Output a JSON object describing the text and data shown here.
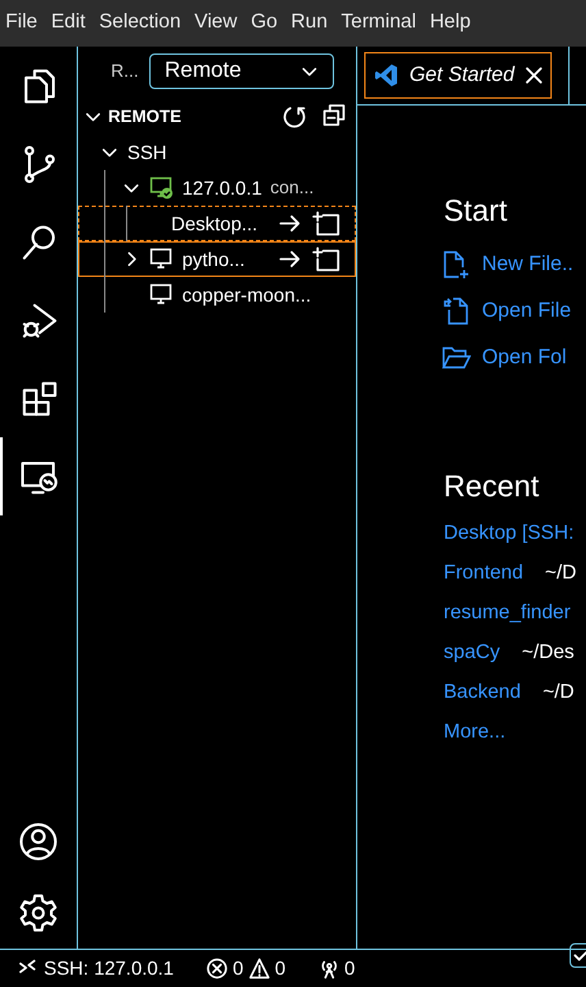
{
  "menu_bar": [
    "File",
    "Edit",
    "Selection",
    "View",
    "Go",
    "Run",
    "Terminal",
    "Help"
  ],
  "activity_bar": [
    {
      "kind": "files",
      "selected": false
    },
    {
      "kind": "branch",
      "selected": false
    },
    {
      "kind": "search",
      "selected": false
    },
    {
      "kind": "debug",
      "selected": false
    },
    {
      "kind": "extensions",
      "selected": false
    },
    {
      "kind": "remote",
      "selected": true
    }
  ],
  "activity_bar_bottom": [
    {
      "kind": "account"
    },
    {
      "kind": "settings"
    }
  ],
  "sidebar": {
    "label": "R...",
    "dropdown": "Remote",
    "section": {
      "title": "REMOTE",
      "expanded": true
    },
    "tree": [
      {
        "label": "SSH",
        "expanded": true,
        "children": [
          {
            "label": "127.0.0.1",
            "description": "con...",
            "kind": "connected-host",
            "expanded": true,
            "selected": false,
            "focused": false,
            "actions": false,
            "children": [
              {
                "label": "Desktop...",
                "selected": false,
                "focused": true,
                "actions": true
              }
            ]
          },
          {
            "label": "pytho...",
            "kind": "host",
            "expanded": false,
            "selected": true,
            "focused": false,
            "actions": true
          },
          {
            "label": "copper-moon...",
            "kind": "host",
            "selected": false,
            "focused": false,
            "actions": false
          }
        ]
      }
    ]
  },
  "tabs": [
    {
      "label": "Get Started",
      "selected": true
    }
  ],
  "start": {
    "title": "Start",
    "items": [
      {
        "kind": "new-file",
        "label": "New File.."
      },
      {
        "kind": "open-file",
        "label": "Open File"
      },
      {
        "kind": "open-folder",
        "label": "Open Fol"
      }
    ]
  },
  "recent": {
    "title": "Recent",
    "items": [
      {
        "name": "Desktop [SSH:"
      },
      {
        "name": "Frontend",
        "path": "~/D"
      },
      {
        "name": "resume_finder"
      },
      {
        "name": "spaCy",
        "path": "~/Des"
      },
      {
        "name": "Backend",
        "path": "~/D"
      }
    ],
    "more": "More..."
  },
  "show_on_startup": {
    "checked": true
  },
  "status_bar": {
    "remote": "SSH: 127.0.0.1",
    "errors": "0",
    "warnings": "0",
    "ports": "0"
  }
}
